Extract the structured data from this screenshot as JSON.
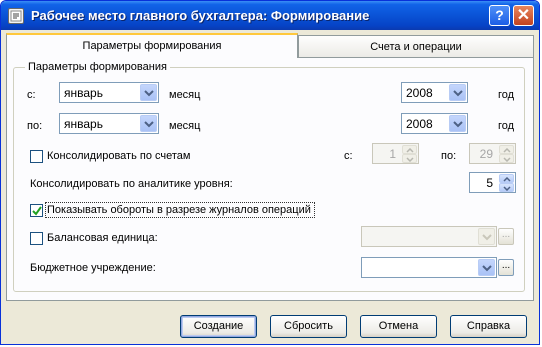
{
  "window": {
    "title": "Рабочее место главного бухгалтера: Формирование"
  },
  "tabs": [
    {
      "label": "Параметры формирования",
      "active": true
    },
    {
      "label": "Счета и операции",
      "active": false
    }
  ],
  "group": {
    "title": "Параметры формирования"
  },
  "from": {
    "label": "с:",
    "month": "январь",
    "month_label": "месяц",
    "year": "2008",
    "year_label": "год"
  },
  "to": {
    "label": "по:",
    "month": "январь",
    "month_label": "месяц",
    "year": "2008",
    "year_label": "год"
  },
  "consolidate_accounts": {
    "label": "Консолидировать по счетам",
    "checked": false,
    "from_label": "с:",
    "from_value": "1",
    "to_label": "по:",
    "to_value": "29"
  },
  "consolidate_level": {
    "label": "Консолидировать по аналитике уровня:",
    "value": "5"
  },
  "show_turnover": {
    "label": "Показывать обороты в разрезе журналов операций",
    "checked": true
  },
  "balance_unit": {
    "label": "Балансовая единица:",
    "checked": false,
    "value": ""
  },
  "budget_institution": {
    "label": "Бюджетное учреждение:",
    "value": ""
  },
  "buttons": {
    "create": "Создание",
    "reset": "Сбросить",
    "cancel": "Отмена",
    "help": "Справка"
  },
  "icons": {
    "help": "?",
    "close": "✕",
    "ellipsis": "..."
  },
  "colors": {
    "titlebar": "#0a53d6",
    "face": "#ece9d8",
    "check": "#21a121"
  }
}
